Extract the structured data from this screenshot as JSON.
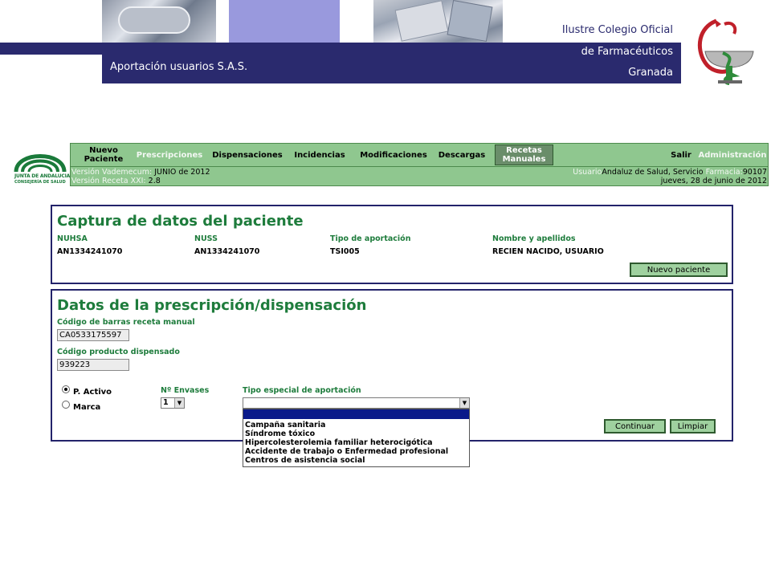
{
  "slide": {
    "subtitle": "Aportación usuarios S.A.S.",
    "college_line1": "Ilustre Colegio Oficial",
    "college_line2": "de Farmacéuticos",
    "college_line3": "Granada"
  },
  "brand": {
    "logo_line1": "JUNTA DE ANDALUCIA",
    "logo_line2": "CONSEJERÍA DE SALUD"
  },
  "nav": {
    "nuevo_paciente": "Nuevo Paciente",
    "prescripciones": "Prescripciones",
    "dispensaciones": "Dispensaciones",
    "incidencias": "Incidencias",
    "modificaciones": "Modificaciones",
    "descargas": "Descargas",
    "recetas_manuales": "Recetas Manuales",
    "salir": "Salir",
    "administracion": "Administración"
  },
  "info": {
    "vademecum_label": "Versión Vademecum:",
    "vademecum_value": "JUNIO de 2012",
    "receta_label": "Versión Receta XXI:",
    "receta_value": "2.8",
    "usuario_label": "Usuario",
    "usuario_value": "Andaluz de Salud, Servicio",
    "farmacia_label": "Farmacia:",
    "farmacia_value": "90107",
    "date": "jueves, 28 de junio de 2012"
  },
  "patient": {
    "title": "Captura de datos del paciente",
    "nuhsa_label": "NUHSA",
    "nuhsa_value": "AN1334241070",
    "nuss_label": "NUSS",
    "nuss_value": "AN1334241070",
    "tipo_label": "Tipo de aportación",
    "tipo_value": "TSI005",
    "nombre_label": "Nombre y apellidos",
    "nombre_value": "RECIEN NACIDO, USUARIO",
    "new_patient_button": "Nuevo paciente"
  },
  "prescription": {
    "title": "Datos de la prescripción/dispensación",
    "barcode_label": "Código de barras receta manual",
    "barcode_value": "CA0533175597",
    "product_label": "Código producto dispensado",
    "product_value": "939223",
    "radio_active": "P. Activo",
    "radio_brand": "Marca",
    "envases_label": "Nº Envases",
    "envases_value": "1",
    "special_label": "Tipo especial de aportación",
    "special_value": "",
    "options": [
      "Campaña sanitaria",
      "Síndrome tóxico",
      "Hipercolesterolemia familiar heterocigótica",
      "Accidente de trabajo o Enfermedad profesional",
      "Centros de asistencia social"
    ],
    "continue_button": "Continuar",
    "clear_button": "Limpiar"
  }
}
